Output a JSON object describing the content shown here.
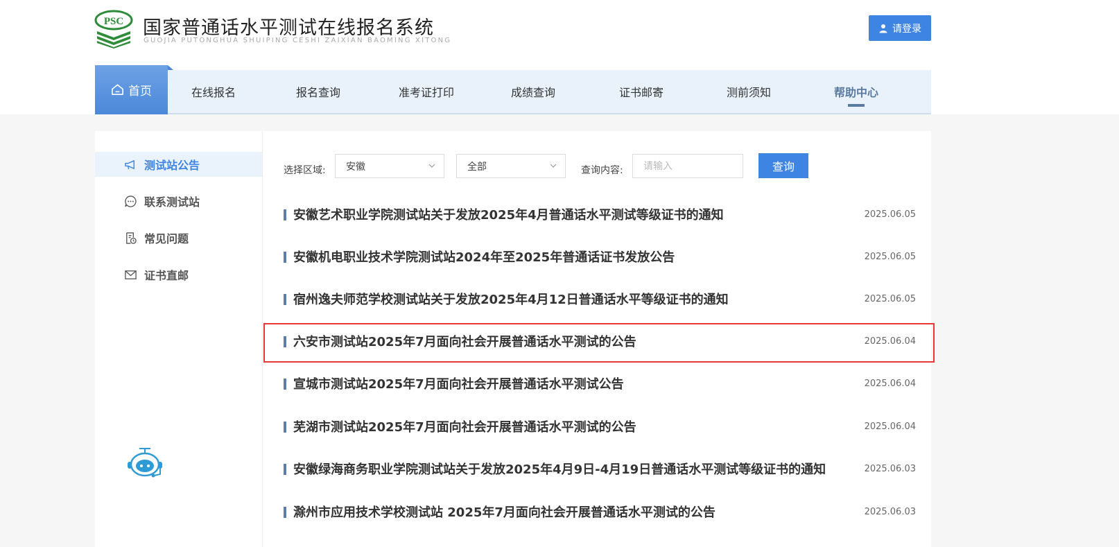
{
  "header": {
    "logo_badge": "PSC",
    "site_title": "国家普通话水平测试在线报名系统",
    "site_subtitle": "GUOJIA PUTONGHUA SHUIPING CESHI ZAIXIAN BAOMING XITONG",
    "login_label": "请登录"
  },
  "nav": {
    "home": "首页",
    "items": [
      "在线报名",
      "报名查询",
      "准考证打印",
      "成绩查询",
      "证书邮寄",
      "测前须知",
      "帮助中心"
    ]
  },
  "sidebar": {
    "items": [
      {
        "label": "测试站公告",
        "icon": "megaphone-icon"
      },
      {
        "label": "联系测试站",
        "icon": "chat-bubble-icon"
      },
      {
        "label": "常见问题",
        "icon": "document-clock-icon"
      },
      {
        "label": "证书直邮",
        "icon": "envelope-icon"
      }
    ]
  },
  "filter": {
    "region_label": "选择区域:",
    "province_value": "安徽",
    "city_value": "全部",
    "query_label": "查询内容:",
    "search_placeholder": "请输入",
    "query_button": "查询"
  },
  "news": [
    {
      "title": "安徽艺术职业学院测试站关于发放2025年4月普通话水平测试等级证书的通知",
      "date": "2025.06.05"
    },
    {
      "title": "安徽机电职业技术学院测试站2024年至2025年普通话证书发放公告",
      "date": "2025.06.05"
    },
    {
      "title": "宿州逸夫师范学校测试站关于发放2025年4月12日普通话水平等级证书的通知",
      "date": "2025.06.05"
    },
    {
      "title": "六安市测试站2025年7月面向社会开展普通话水平测试的公告",
      "date": "2025.06.04"
    },
    {
      "title": "宣城市测试站2025年7月面向社会开展普通话水平测试公告",
      "date": "2025.06.04"
    },
    {
      "title": "芜湖市测试站2025年7月面向社会开展普通话水平测试的公告",
      "date": "2025.06.04"
    },
    {
      "title": "安徽绿海商务职业学院测试站关于发放2025年4月9日-4月19日普通话水平测试等级证书的通知",
      "date": "2025.06.03"
    },
    {
      "title": "滁州市应用技术学校测试站 2025年7月面向社会开展普通话水平测试的公告",
      "date": "2025.06.03"
    }
  ],
  "colors": {
    "accent": "#3d84e3",
    "highlight_border": "#e53935",
    "nav_bg": "#e9f2fb"
  }
}
